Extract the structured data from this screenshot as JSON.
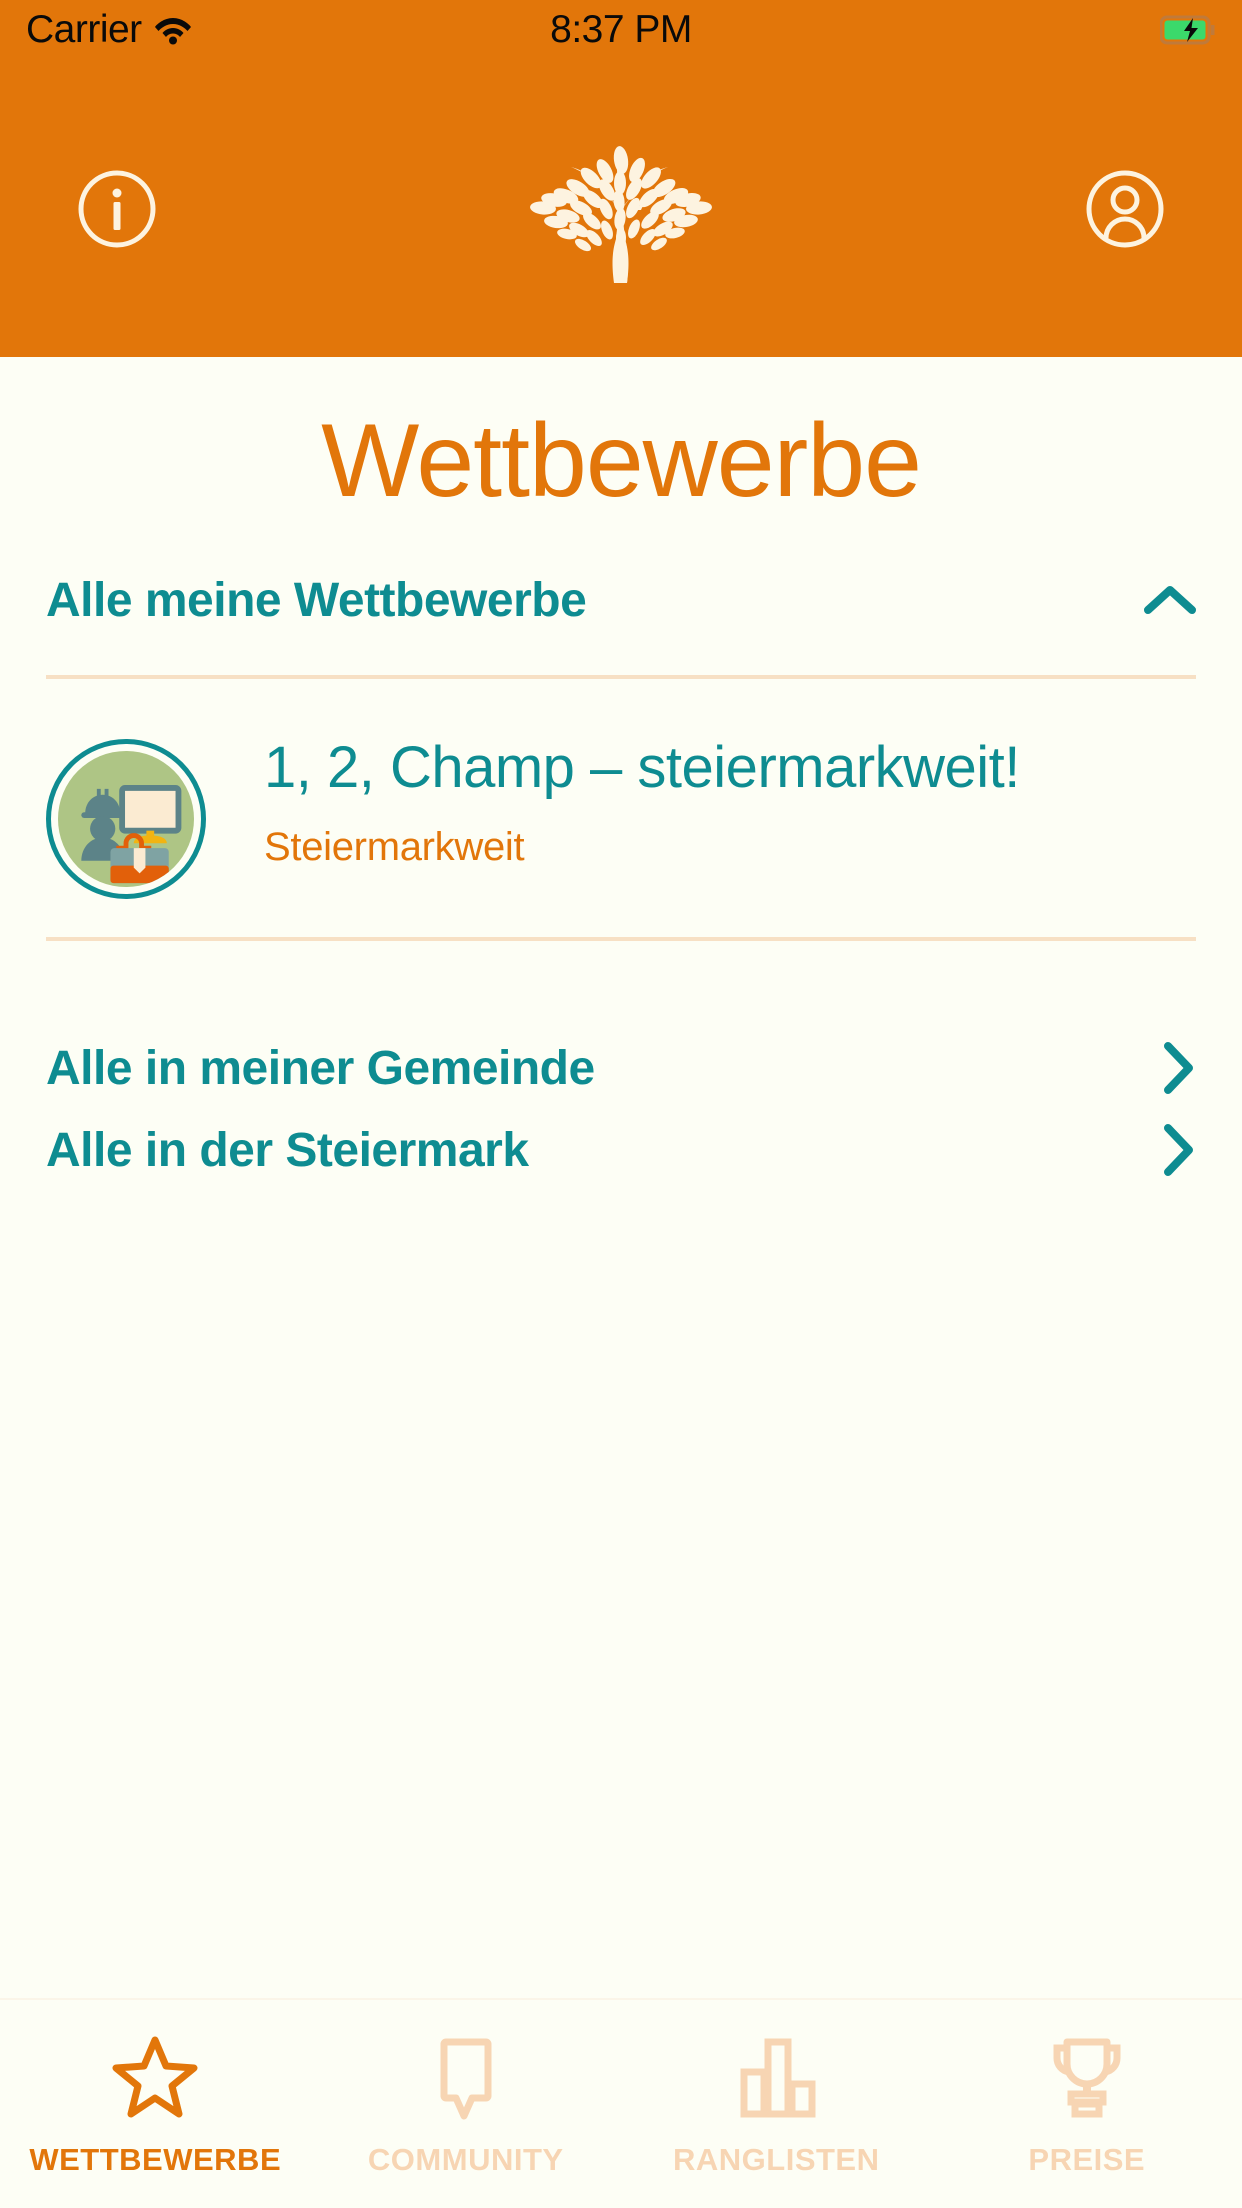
{
  "colors": {
    "brand_orange": "#E2760A",
    "teal": "#0E8C91",
    "background": "#FDFEF5",
    "divider": "#F7E0C4",
    "avatar_green": "#AEC585",
    "tab_inactive": "#F7D5B3",
    "status_text": "#0A0A0A"
  },
  "statusbar": {
    "carrier": "Carrier",
    "time": "8:37 PM",
    "wifi_icon": "wifi-icon",
    "battery_icon": "battery-charging-icon"
  },
  "header": {
    "info_icon": "info-circle-icon",
    "logo_icon": "tree-logo-icon",
    "account_icon": "account-circle-icon"
  },
  "main": {
    "page_title": "Wettbewerbe",
    "section": {
      "title": "Alle meine Wettbewerbe",
      "toggle_icon": "chevron-up-icon",
      "expanded": true
    },
    "competitions": [
      {
        "title": "1, 2, Champ – steiermarkweit!",
        "subtitle": "Steiermarkweit",
        "avatar_icon": "worker-monitor-briefcase-icon"
      }
    ],
    "nav_links": [
      {
        "label": "Alle in meiner Gemeinde",
        "icon": "chevron-right-icon"
      },
      {
        "label": "Alle in der Steiermark",
        "icon": "chevron-right-icon"
      }
    ]
  },
  "tabbar": {
    "tabs": [
      {
        "label": "WETTBEWERBE",
        "icon": "star-icon",
        "active": true
      },
      {
        "label": "COMMUNITY",
        "icon": "speech-bubble-icon",
        "active": false
      },
      {
        "label": "RANGLISTEN",
        "icon": "bar-chart-icon",
        "active": false
      },
      {
        "label": "PREISE",
        "icon": "trophy-icon",
        "active": false
      }
    ]
  }
}
